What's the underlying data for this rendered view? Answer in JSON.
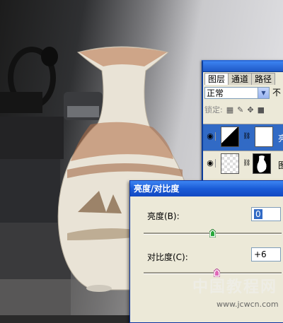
{
  "layers_panel": {
    "tabs": [
      "图层",
      "通道",
      "路径"
    ],
    "blend_mode": "正常",
    "opacity_label": "不",
    "lock_label": "锁定:",
    "layers": [
      {
        "name": "亮",
        "selected": true
      },
      {
        "name": "图层",
        "selected": false
      }
    ]
  },
  "dialog": {
    "title": "亮度/对比度",
    "brightness_label": "亮度(B):",
    "brightness_value": "0",
    "brightness_slider_fraction": 0.5,
    "contrast_label": "对比度(C):",
    "contrast_value": "+6",
    "contrast_slider_fraction": 0.53
  },
  "watermark": {
    "text": "中国教程网",
    "url": "www.jcwcn.com"
  },
  "colors": {
    "titlebar": "#1a5bd6",
    "selection": "#316ac5",
    "panel": "#ece9d8"
  }
}
